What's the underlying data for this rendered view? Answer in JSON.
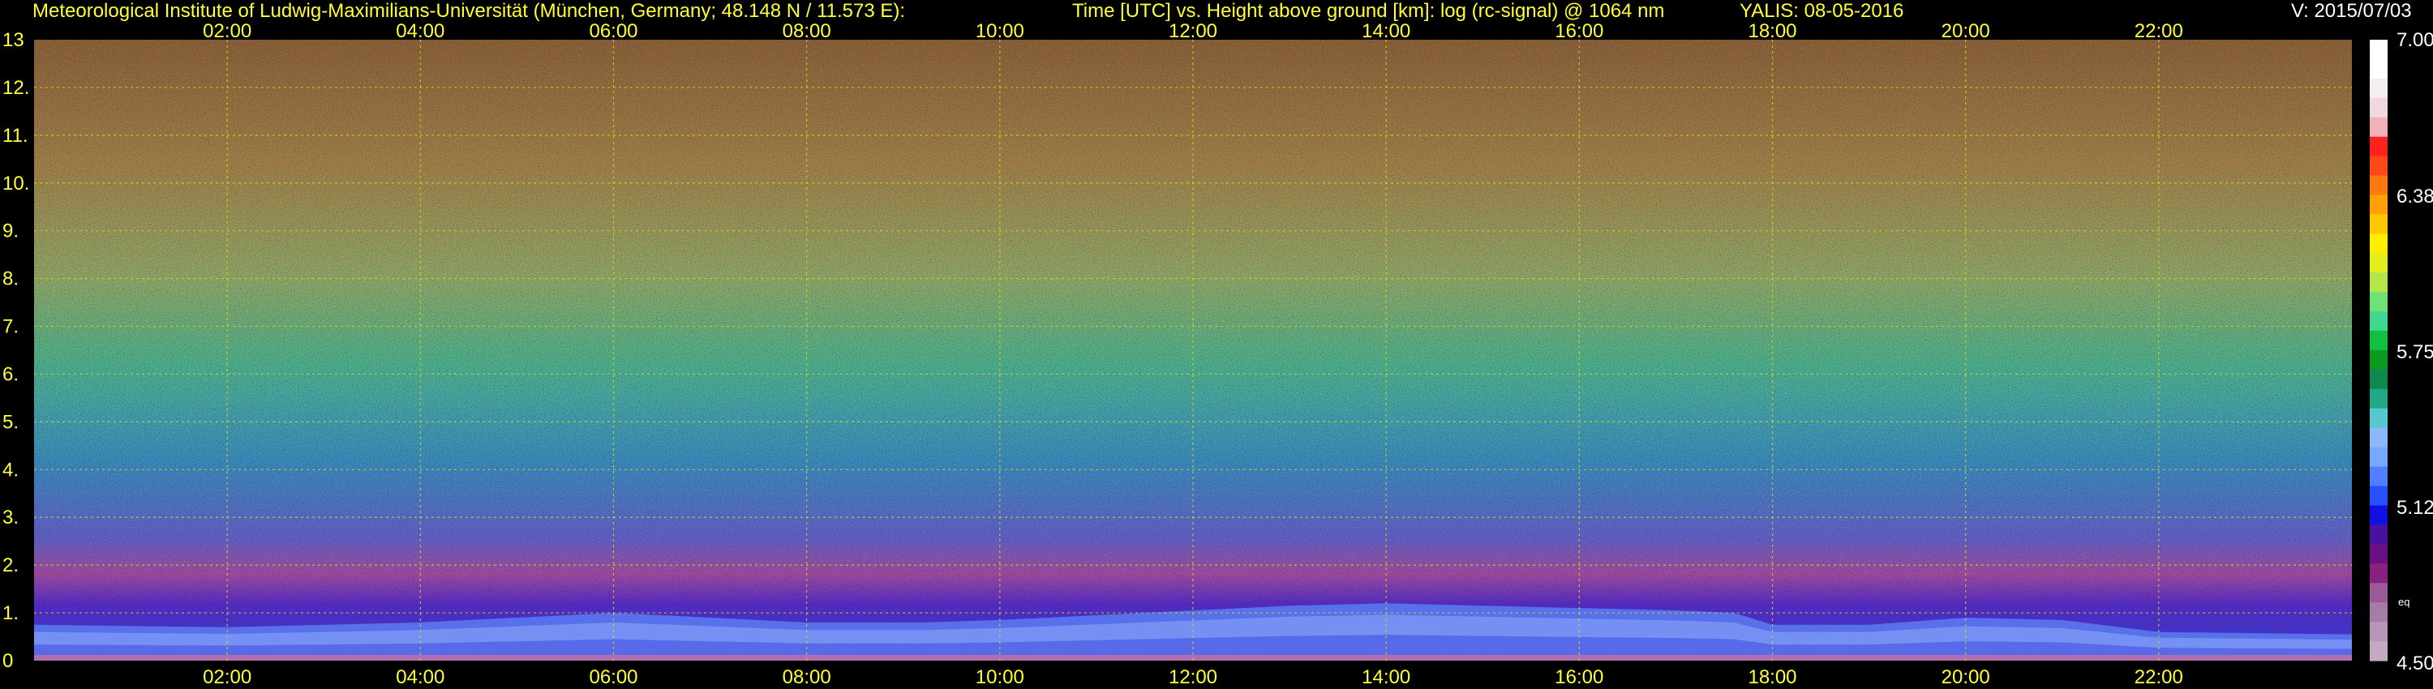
{
  "header": {
    "institute": "Meteorological Institute of Ludwig-Maximilians-Universität (München, Germany; 48.148 N / 11.573 E):",
    "title": "Time [UTC] vs. Height above ground [km]: log (rc-signal) @ 1064 nm",
    "station_date": "YALIS: 08-05-2016",
    "version": "V: 2015/07/03"
  },
  "chart_data": {
    "type": "heatmap",
    "title": "Time [UTC] vs. Height above ground [km]: log (rc-signal) @ 1064 nm",
    "x_range_hours": [
      0,
      24
    ],
    "x_ticks": [
      "02:00",
      "04:00",
      "06:00",
      "08:00",
      "10:00",
      "12:00",
      "14:00",
      "16:00",
      "18:00",
      "20:00",
      "22:00"
    ],
    "y_range_km": [
      0,
      13
    ],
    "y_ticks": [
      "0",
      "1.",
      "2.",
      "3.",
      "4.",
      "5.",
      "6.",
      "7.",
      "8.",
      "9.",
      "10.",
      "11.",
      "12.",
      "13"
    ],
    "grid": true,
    "colorbar": {
      "min": 4.5,
      "max": 7.0,
      "labels": [
        "7.00",
        "6.38",
        "5.75",
        "5.12",
        "4.50"
      ],
      "extra_label": "eq",
      "colors": [
        "#ffffff",
        "#ffffff",
        "#f4eef2",
        "#efd8de",
        "#f0b2b8",
        "#ff2020",
        "#ff4818",
        "#ff7810",
        "#ffa008",
        "#ffc800",
        "#ffee00",
        "#e2ee20",
        "#b4e64a",
        "#70e078",
        "#40d890",
        "#10c040",
        "#0a9a20",
        "#108850",
        "#20a888",
        "#58c8d0",
        "#8ab8f8",
        "#78a8ff",
        "#5080ff",
        "#2850ff",
        "#1010e0",
        "#4a10a0",
        "#6a1080",
        "#882280",
        "#9a5a98",
        "#a57ca8",
        "#b896b6",
        "#c4a8c4"
      ]
    },
    "boundary_layer_top_km": [
      [
        0,
        0.75
      ],
      [
        2,
        0.7
      ],
      [
        4,
        0.8
      ],
      [
        6,
        1.0
      ],
      [
        8,
        0.8
      ],
      [
        9.2,
        0.8
      ],
      [
        10,
        0.85
      ],
      [
        11,
        0.95
      ],
      [
        12,
        1.05
      ],
      [
        13,
        1.15
      ],
      [
        14,
        1.2
      ],
      [
        15,
        1.15
      ],
      [
        16,
        1.1
      ],
      [
        17,
        1.05
      ],
      [
        17.6,
        1.0
      ],
      [
        18,
        0.75
      ],
      [
        19,
        0.75
      ],
      [
        20,
        0.9
      ],
      [
        21,
        0.85
      ],
      [
        22,
        0.6
      ],
      [
        24,
        0.55
      ]
    ]
  }
}
